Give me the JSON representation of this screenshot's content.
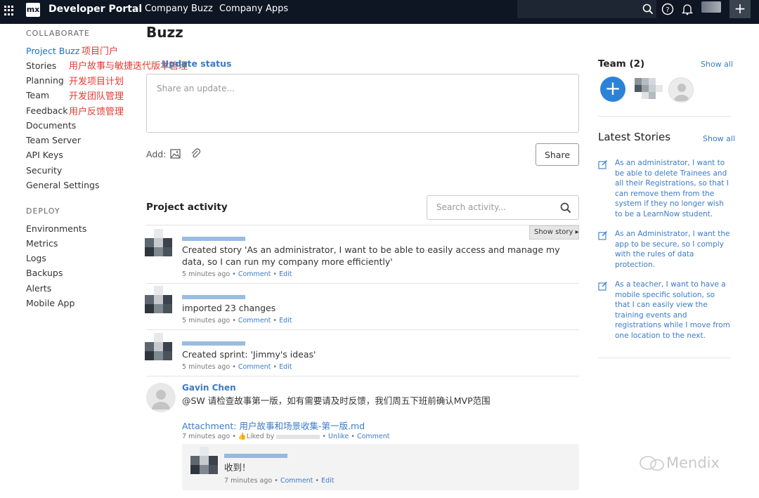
{
  "topbar": {
    "brand": "Developer Portal",
    "logo_text": "mx",
    "nav": [
      "Company Buzz",
      "Company Apps"
    ],
    "plus": "+"
  },
  "sidebar": {
    "collaborate_heading": "COLLABORATE",
    "collaborate_items": [
      {
        "label": "Project Buzz",
        "active": true
      },
      {
        "label": "Stories"
      },
      {
        "label": "Planning"
      },
      {
        "label": "Team"
      },
      {
        "label": "Feedback"
      },
      {
        "label": "Documents"
      },
      {
        "label": "Team Server"
      },
      {
        "label": "API Keys"
      },
      {
        "label": "Security"
      },
      {
        "label": "General Settings"
      }
    ],
    "deploy_heading": "DEPLOY",
    "deploy_items": [
      "Environments",
      "Metrics",
      "Logs",
      "Backups",
      "Alerts",
      "Mobile App"
    ]
  },
  "annotations": [
    "项目门户",
    "用户故事与敏捷迭代版本管理",
    "开发项目计划",
    "开发团队管理",
    "用户反馈管理"
  ],
  "main": {
    "title": "Buzz",
    "update_status": "Update status",
    "share_placeholder": "Share an update...",
    "add_label": "Add:",
    "share_button": "Share",
    "project_activity": "Project activity",
    "search_placeholder": "Search activity...",
    "show_story": "Show story",
    "activities": [
      {
        "text": "Created story 'As an administrator, I want to be able to easily access and manage my data, so I can run my company more efficiently'",
        "time": "5 minutes ago",
        "comment": "Comment",
        "edit": "Edit"
      },
      {
        "text": "imported 23 changes",
        "time": "5 minutes ago",
        "comment": "Comment",
        "edit": "Edit"
      },
      {
        "text": "Created sprint: 'Jimmy's ideas'",
        "time": "5 minutes ago",
        "comment": "Comment",
        "edit": "Edit"
      },
      {
        "user": "Gavin Chen",
        "text": "@SW 请检查故事第一版，如有需要请及时反馈，我们周五下班前确认MVP范围",
        "attachment": "Attachment: 用户故事和场景收集-第一版.md",
        "time": "7 minutes ago",
        "liked_by": "Liked by",
        "unlike": "Unlike",
        "comment": "Comment"
      }
    ],
    "reply": {
      "text": "收到！",
      "time": "7 minutes ago",
      "comment": "Comment",
      "edit": "Edit"
    }
  },
  "right": {
    "team_heading": "Team (2)",
    "show_all": "Show all",
    "latest_stories": "Latest Stories",
    "stories": [
      "As an administrator, I want to be able to delete Trainees and all their Registrations, so that I can remove them from the system if they no longer wish to be a LearnNow student.",
      "As an Administrator, I want the app to be secure, so I comply with the rules of data protection.",
      "As a teacher, I want to have a mobile specific solution, so that I can easily view the training events and registrations while I move from one location to the next."
    ]
  },
  "watermark": "Mendix",
  "colors": {
    "topbar": "#0e1623",
    "link": "#3a7bc8",
    "annotation": "#e53935",
    "accent": "#2c83d6"
  }
}
